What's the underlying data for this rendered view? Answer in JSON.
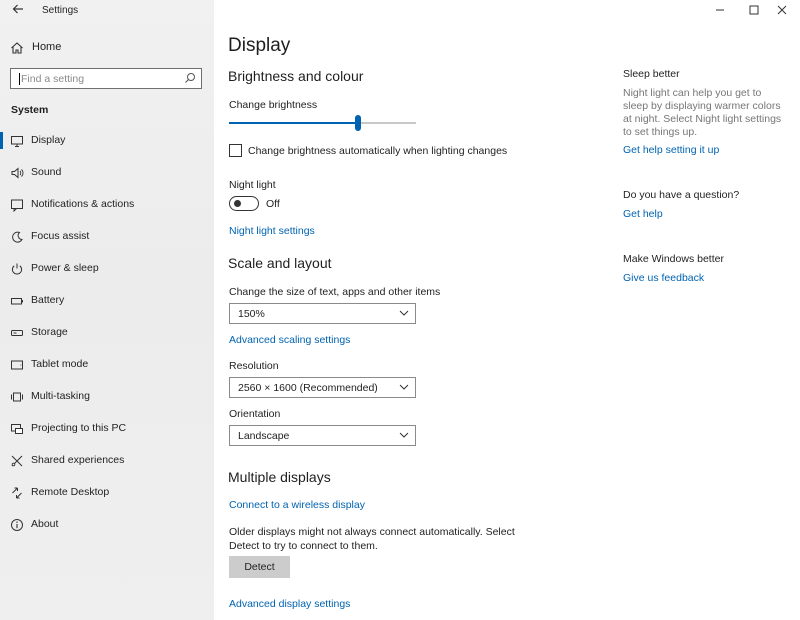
{
  "window": {
    "title": "Settings",
    "back_icon": "back-arrow-icon",
    "controls": [
      "minimize-icon",
      "maximize-icon",
      "close-icon"
    ]
  },
  "sidebar": {
    "home_label": "Home",
    "search_placeholder": "Find a setting",
    "section_label": "System",
    "items": [
      {
        "label": "Display",
        "icon": "monitor-icon",
        "active": true
      },
      {
        "label": "Sound",
        "icon": "speaker-icon"
      },
      {
        "label": "Notifications & actions",
        "icon": "notification-icon"
      },
      {
        "label": "Focus assist",
        "icon": "moon-icon"
      },
      {
        "label": "Power & sleep",
        "icon": "power-icon"
      },
      {
        "label": "Battery",
        "icon": "battery-icon"
      },
      {
        "label": "Storage",
        "icon": "storage-icon"
      },
      {
        "label": "Tablet mode",
        "icon": "tablet-icon"
      },
      {
        "label": "Multi-tasking",
        "icon": "multitasking-icon"
      },
      {
        "label": "Projecting to this PC",
        "icon": "projecting-icon"
      },
      {
        "label": "Shared experiences",
        "icon": "shared-icon"
      },
      {
        "label": "Remote Desktop",
        "icon": "remote-desktop-icon"
      },
      {
        "label": "About",
        "icon": "info-icon"
      }
    ]
  },
  "main": {
    "title": "Display",
    "brightness": {
      "heading": "Brightness and colour",
      "slider_label": "Change brightness",
      "brightness_fraction": 0.69,
      "auto_checkbox_label": "Change brightness automatically when lighting changes",
      "auto_checked": false,
      "night_light_label": "Night light",
      "night_light_state": "Off",
      "night_light_link": "Night light settings"
    },
    "scale": {
      "heading": "Scale and layout",
      "size_label": "Change the size of text, apps and other items",
      "size_value": "150%",
      "advanced_scaling_link": "Advanced scaling settings",
      "resolution_label": "Resolution",
      "resolution_value": "2560 × 1600 (Recommended)",
      "orientation_label": "Orientation",
      "orientation_value": "Landscape"
    },
    "multiple": {
      "heading": "Multiple displays",
      "wireless_link": "Connect to a wireless display",
      "detect_text_line1": "Older displays might not always connect automatically. Select",
      "detect_text_line2": "Detect to try to connect to them.",
      "detect_button": "Detect",
      "advanced_display_link": "Advanced display settings"
    }
  },
  "aside": {
    "sleep_heading": "Sleep better",
    "sleep_lines": [
      "Night light can help you get to",
      "sleep by displaying warmer colors",
      "at night. Select Night light settings",
      "to set things up."
    ],
    "sleep_link": "Get help setting it up",
    "question_heading": "Do you have a question?",
    "question_link": "Get help",
    "feedback_heading": "Make Windows better",
    "feedback_link": "Give us feedback"
  },
  "colors": {
    "accent": "#0063b1",
    "sidebar_bg": "#efefef"
  }
}
